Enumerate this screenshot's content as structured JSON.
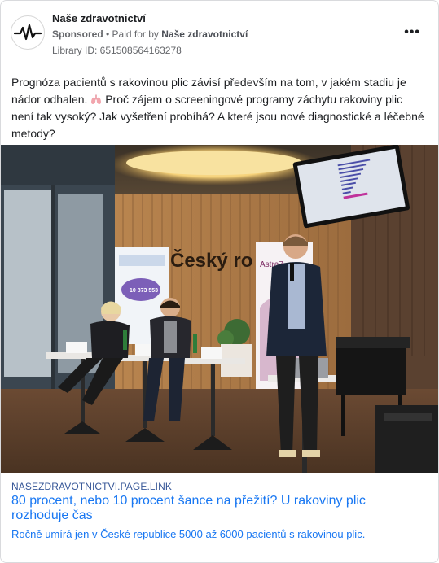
{
  "post": {
    "page_name": "Naše zdravotnictví",
    "sponsored_label": "Sponsored",
    "separator": " • ",
    "paid_for_by_label": "Paid for by",
    "paid_for_by_name": "Naše zdravotnictví",
    "library_id": "Library ID: 651508564163278",
    "more_icon": "more-options-icon",
    "text_part1": "Prognóza pacientů s rakovinou plic závisí především na tom, v jakém stadiu je nádor odhalen.",
    "emoji_icon": "lungs-icon",
    "text_part2": "Proč zájem o screeningové programy záchytu rakoviny plic není tak vysoký? Jak vyšetření probíhá? A které jsou nové diagnostické a léčebné metody?"
  },
  "photo": {
    "banner_text": "Český ro",
    "banner_number": "10 873 553",
    "astra_text": "AstraZ"
  },
  "link": {
    "domain": "NASEZDRAVOTNICTVI.PAGE.LINK",
    "headline": "80 procent, nebo 10 procent šance na přežití? U rakoviny plic rozhoduje čas",
    "description": "Ročně umírá jen v České republice 5000 až 6000 pacientů s rakovinou plic."
  },
  "colors": {
    "link_blue": "#1877f2",
    "domain_blue": "#385898",
    "meta_gray": "#65676b",
    "text": "#1c1e21"
  }
}
